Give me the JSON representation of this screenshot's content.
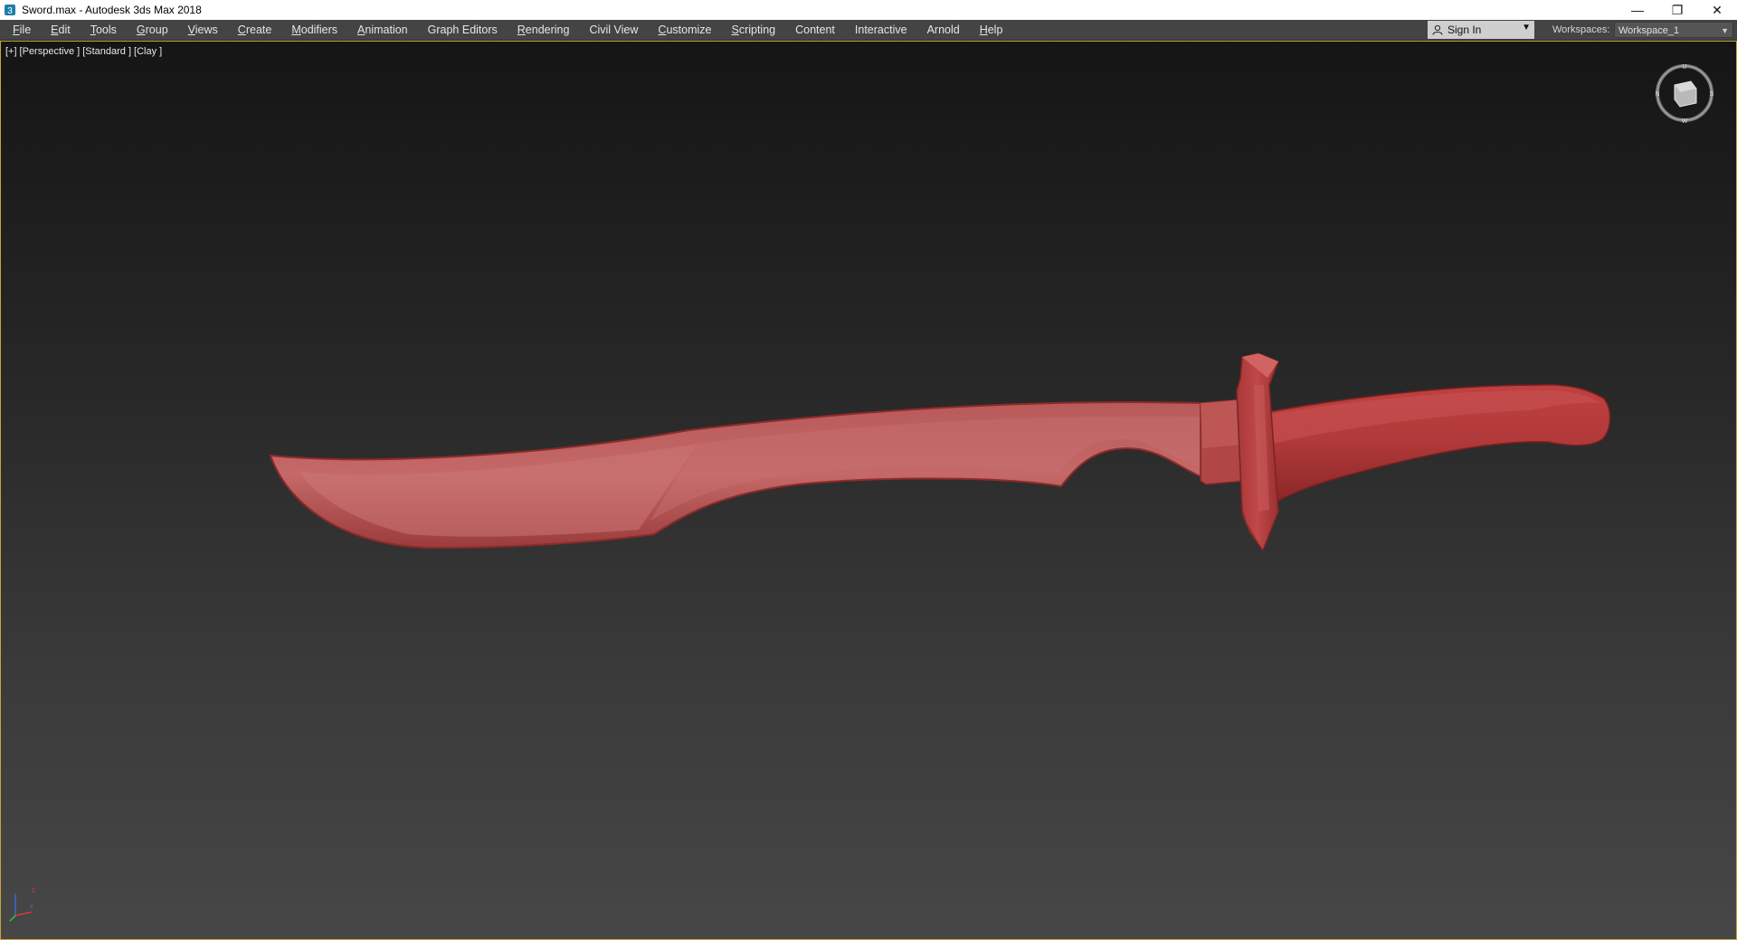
{
  "window": {
    "title": "Sword.max - Autodesk 3ds Max 2018",
    "controls": {
      "minimize": "—",
      "restore": "❐",
      "close": "✕"
    }
  },
  "menu": {
    "items": [
      {
        "label": "File",
        "u": "F",
        "rest": "ile"
      },
      {
        "label": "Edit",
        "u": "E",
        "rest": "dit"
      },
      {
        "label": "Tools",
        "u": "T",
        "rest": "ools"
      },
      {
        "label": "Group",
        "u": "G",
        "rest": "roup"
      },
      {
        "label": "Views",
        "u": "V",
        "rest": "iews"
      },
      {
        "label": "Create",
        "u": "C",
        "rest": "reate"
      },
      {
        "label": "Modifiers",
        "u": "M",
        "rest": "odifiers"
      },
      {
        "label": "Animation",
        "u": "A",
        "rest": "nimation"
      },
      {
        "label": "Graph Editors",
        "u": "",
        "rest": "Graph Editors"
      },
      {
        "label": "Rendering",
        "u": "R",
        "rest": "endering"
      },
      {
        "label": "Civil View",
        "u": "",
        "rest": "Civil View"
      },
      {
        "label": "Customize",
        "u": "C",
        "rest": "ustomize"
      },
      {
        "label": "Scripting",
        "u": "S",
        "rest": "cripting"
      },
      {
        "label": "Content",
        "u": "",
        "rest": "Content"
      },
      {
        "label": "Interactive",
        "u": "",
        "rest": "Interactive"
      },
      {
        "label": "Arnold",
        "u": "",
        "rest": "Arnold"
      },
      {
        "label": "Help",
        "u": "H",
        "rest": "elp"
      }
    ],
    "signin_label": "Sign In",
    "workspaces_label": "Workspaces:",
    "workspace_value": "Workspace_1"
  },
  "viewport": {
    "labels": [
      "[+]",
      "[Perspective ]",
      "[Standard ]",
      "[Clay ]"
    ],
    "model_color": "#c05555",
    "viewcube_letters": {
      "top": "U",
      "left": "N",
      "right": "S",
      "bottom": "W"
    },
    "axis_letters": {
      "z": "z",
      "x": "x",
      "y": "y"
    }
  },
  "colors": {
    "menubar": "#444444",
    "viewport_border": "#c9a23a",
    "axis_x": "#d33a3a",
    "axis_y": "#3ac43a",
    "axis_z": "#3a6ad3"
  }
}
